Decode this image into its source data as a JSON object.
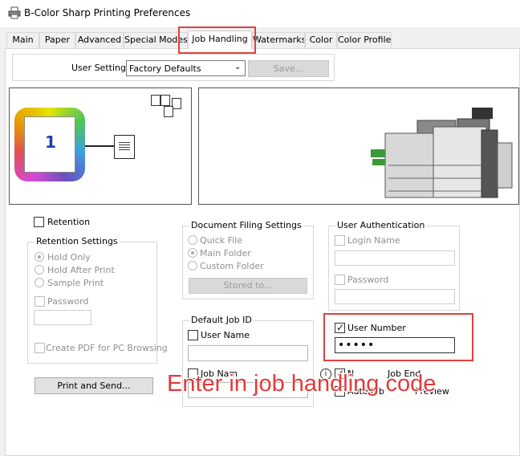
{
  "window": {
    "title": "B-Color Sharp Printing Preferences",
    "icon": "printer-icon"
  },
  "tabs": [
    {
      "label": "Main",
      "active": false
    },
    {
      "label": "Paper",
      "active": false
    },
    {
      "label": "Advanced",
      "active": false
    },
    {
      "label": "Special Modes",
      "active": false
    },
    {
      "label": "Job Handling",
      "active": true
    },
    {
      "label": "Watermarks",
      "active": false
    },
    {
      "label": "Color",
      "active": false
    },
    {
      "label": "Color Profile",
      "active": false
    }
  ],
  "user_settings": {
    "label": "User Settings:",
    "value": "Factory Defaults",
    "save_label": "Save..."
  },
  "preview": {
    "page_number": "1"
  },
  "retention": {
    "checkbox_label": "Retention",
    "group_title": "Retention Settings",
    "options": [
      "Hold Only",
      "Hold After Print",
      "Sample Print"
    ],
    "selected": "Hold Only",
    "password_label": "Password",
    "pdf_label": "Create PDF for PC Browsing"
  },
  "print_send_label": "Print and Send...",
  "document_filing": {
    "title": "Document Filing Settings",
    "options": [
      "Quick File",
      "Main Folder",
      "Custom Folder"
    ],
    "selected": "Main Folder",
    "stored_to_label": "Stored to..."
  },
  "default_job_id": {
    "title": "Default Job ID",
    "user_name_label": "User Name",
    "job_name_label": "Job Nam"
  },
  "user_authentication": {
    "title": "User Authentication",
    "login_name_label": "Login Name",
    "password_label": "Password"
  },
  "user_number": {
    "label": "User Number",
    "checked": true,
    "value": "•••••"
  },
  "partial": {
    "label_a": "N",
    "label_b": "Job End",
    "label_c": "Auto Job",
    "label_d": "Preview"
  },
  "annotation": {
    "text": "Enter in job handling code",
    "color": "#e23a3a"
  },
  "colors": {
    "highlight": "#e04040",
    "accent_blue": "#1a3fb3"
  }
}
